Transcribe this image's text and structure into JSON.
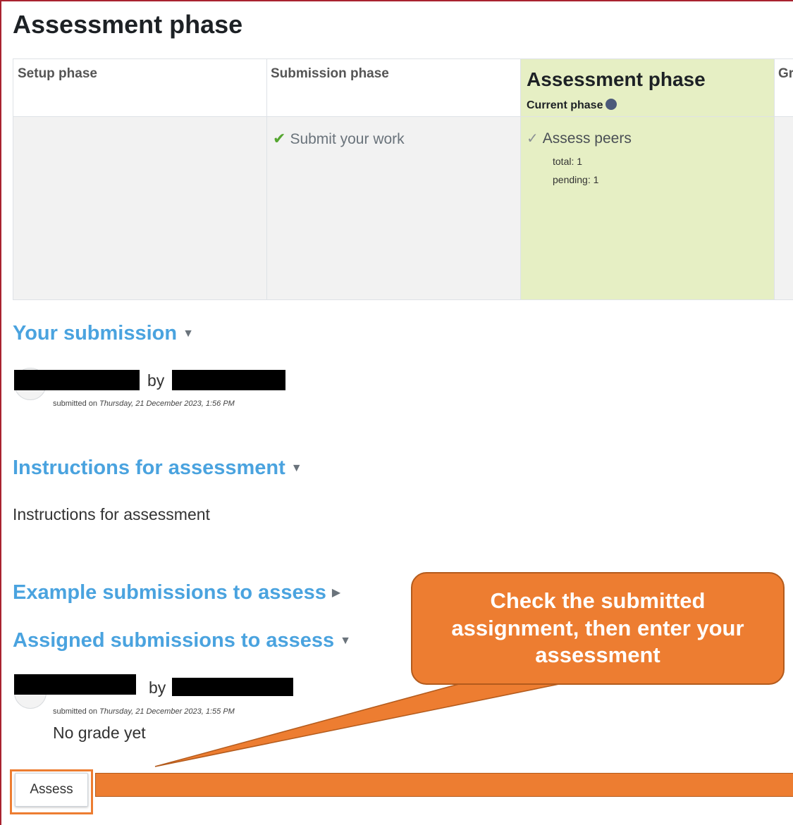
{
  "page_title": "Assessment phase",
  "phases": [
    {
      "name": "Setup phase"
    },
    {
      "name": "Submission phase",
      "task": "Submit your work"
    },
    {
      "name": "Assessment phase",
      "current_label": "Current phase",
      "task": "Assess peers",
      "details": [
        "total: 1",
        "pending: 1"
      ]
    },
    {
      "name": "Gr"
    }
  ],
  "your_submission": {
    "heading": "Your submission",
    "by": "by",
    "submitted_prefix": "submitted on",
    "submitted_date": "Thursday, 21 December 2023, 1:56 PM"
  },
  "instructions": {
    "heading": "Instructions for assessment",
    "text": "Instructions for assessment"
  },
  "examples": {
    "heading": "Example submissions to assess"
  },
  "assigned": {
    "heading": "Assigned submissions to assess",
    "by": "by",
    "submitted_prefix": "submitted on",
    "submitted_date": "Thursday, 21 December 2023, 1:55 PM",
    "grade_status": "No grade yet"
  },
  "assess_button": "Assess",
  "callout_text": "Check the submitted assignment, then enter your assessment",
  "colors": {
    "callout": "#ed7d31",
    "link": "#4aa3df",
    "current_phase_bg": "#e6efc4"
  }
}
